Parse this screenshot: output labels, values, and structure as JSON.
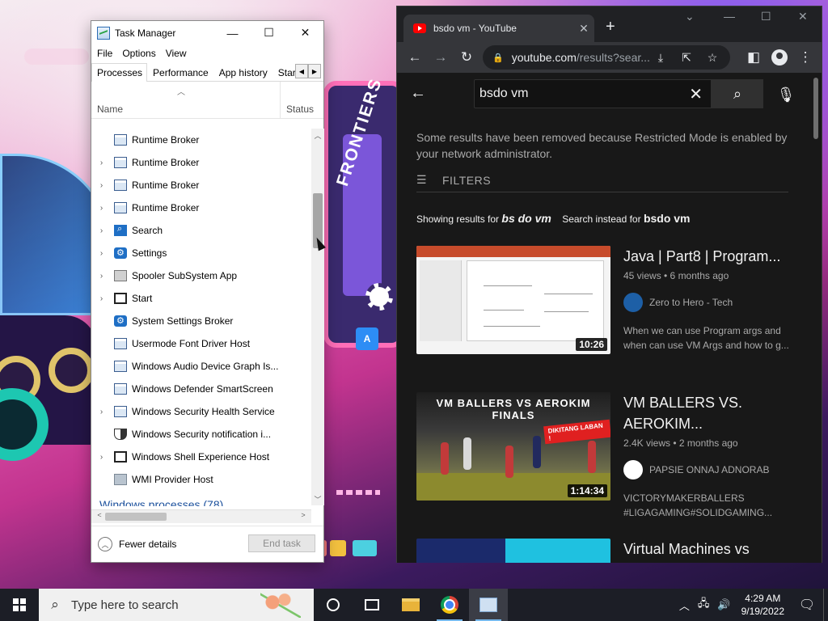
{
  "task_manager": {
    "title": "Task Manager",
    "menu": [
      "File",
      "Options",
      "View"
    ],
    "tabs": [
      "Processes",
      "Performance",
      "App history",
      "Startu"
    ],
    "columns": {
      "name": "Name",
      "status": "Status"
    },
    "processes": [
      {
        "name": "Runtime Broker",
        "expandable": false,
        "icon": "app-window-icon"
      },
      {
        "name": "Runtime Broker",
        "expandable": true,
        "icon": "app-window-icon"
      },
      {
        "name": "Runtime Broker",
        "expandable": true,
        "icon": "app-window-icon"
      },
      {
        "name": "Runtime Broker",
        "expandable": true,
        "icon": "app-window-icon"
      },
      {
        "name": "Search",
        "expandable": true,
        "icon": "search-icon"
      },
      {
        "name": "Settings",
        "expandable": true,
        "icon": "gear-icon"
      },
      {
        "name": "Spooler SubSystem App",
        "expandable": true,
        "icon": "printer-icon"
      },
      {
        "name": "Start",
        "expandable": true,
        "icon": "start-icon"
      },
      {
        "name": "System Settings Broker",
        "expandable": false,
        "icon": "gear-icon"
      },
      {
        "name": "Usermode Font Driver Host",
        "expandable": false,
        "icon": "app-window-icon"
      },
      {
        "name": "Windows Audio Device Graph Is...",
        "expandable": false,
        "icon": "app-window-icon"
      },
      {
        "name": "Windows Defender SmartScreen",
        "expandable": false,
        "icon": "app-window-icon"
      },
      {
        "name": "Windows Security Health Service",
        "expandable": true,
        "icon": "app-window-icon"
      },
      {
        "name": "Windows Security notification i...",
        "expandable": false,
        "icon": "shield-icon"
      },
      {
        "name": "Windows Shell Experience Host",
        "expandable": true,
        "icon": "start-icon"
      },
      {
        "name": "WMI Provider Host",
        "expandable": false,
        "icon": "wmi-icon"
      }
    ],
    "section_cut": "Windows processes (78)",
    "fewer_details": "Fewer details",
    "end_task": "End task"
  },
  "browser": {
    "tab_title": "bsdo vm - YouTube",
    "url_host": "youtube.com",
    "url_rest": "/results?sear...",
    "search_query": "bsdo vm",
    "restricted_notice": "Some results have been removed because Restricted Mode is enabled by your network administrator.",
    "filters_label": "FILTERS",
    "showing_prefix": "Showing results for",
    "showing_term": "bs do vm",
    "instead_prefix": "Search instead for",
    "instead_term": "bsdo vm",
    "results": [
      {
        "title": "Java | Part8 | Program...",
        "meta": "45 views • 6 months ago",
        "channel": "Zero to Hero - Tech",
        "description": "When we can use Program args and when can use VM Args and how to g...",
        "duration": "10:26"
      },
      {
        "title": "VM BALLERS VS. AEROKIM...",
        "meta": "2.4K views • 2 months ago",
        "channel": "PAPSIE ONNAJ ADNORAB",
        "description": "VICTORYMAKERBALLERS #LIGAGAMING#SOLIDGAMING...",
        "duration": "1:14:34",
        "thumb_banner": "VM BALLERS VS AEROKIM FINALS",
        "thumb_tag": "DIKITANG LABAN !"
      },
      {
        "title": "Virtual Machines vs Containers",
        "meta": "",
        "channel": "",
        "description": "",
        "duration": ""
      }
    ]
  },
  "desktop": {
    "cassette_label": "FRONTIERS",
    "tile_letter": "A"
  },
  "taskbar": {
    "search_placeholder": "Type here to search",
    "time": "4:29 AM",
    "date": "9/19/2022"
  }
}
